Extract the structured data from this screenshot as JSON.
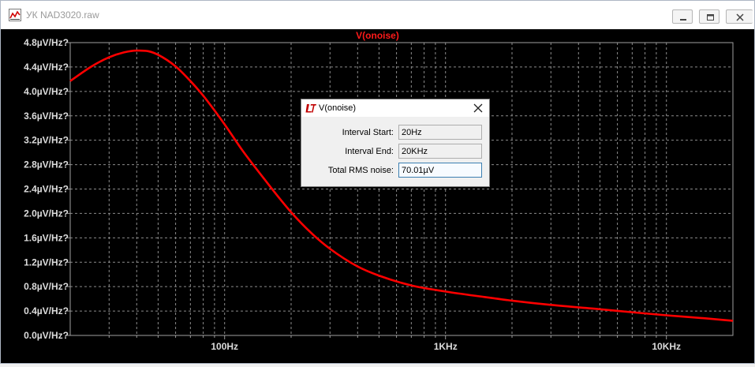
{
  "window": {
    "title": "УК NAD3020.raw",
    "minimize_icon": "minimize-icon",
    "restore_icon": "restore-icon",
    "close_icon": "close-icon"
  },
  "plot": {
    "title": "V(onoise)",
    "trace_color": "#ff0000",
    "background": "#000000"
  },
  "chart_data": {
    "type": "line",
    "title": "V(onoise)",
    "x_scale": "log",
    "x_range_hz": [
      20,
      20000
    ],
    "xlabel": "",
    "ylabel": "",
    "ylim": [
      0.0,
      4.8
    ],
    "grid": true,
    "yticks": [
      "0.0µV/Hz?",
      "0.4µV/Hz?",
      "0.8µV/Hz?",
      "1.2µV/Hz?",
      "1.6µV/Hz?",
      "2.0µV/Hz?",
      "2.4µV/Hz?",
      "2.8µV/Hz?",
      "3.2µV/Hz?",
      "3.6µV/Hz?",
      "4.0µV/Hz?",
      "4.4µV/Hz?",
      "4.8µV/Hz?"
    ],
    "xticks": [
      {
        "hz": 100,
        "label": "100Hz"
      },
      {
        "hz": 1000,
        "label": "1KHz"
      },
      {
        "hz": 10000,
        "label": "10KHz"
      }
    ],
    "series": [
      {
        "name": "V(onoise)",
        "color": "#ff0000",
        "x": [
          20,
          25,
          30,
          35,
          40,
          45,
          50,
          60,
          70,
          80,
          100,
          120,
          150,
          200,
          250,
          300,
          400,
          500,
          700,
          1000,
          1500,
          2000,
          3000,
          5000,
          7000,
          10000,
          15000,
          20000
        ],
        "y": [
          4.17,
          4.41,
          4.56,
          4.64,
          4.67,
          4.66,
          4.6,
          4.41,
          4.17,
          3.93,
          3.46,
          3.04,
          2.58,
          2.02,
          1.66,
          1.42,
          1.13,
          0.98,
          0.82,
          0.72,
          0.63,
          0.57,
          0.5,
          0.43,
          0.38,
          0.33,
          0.28,
          0.24
        ]
      }
    ]
  },
  "dialog": {
    "title": "V(onoise)",
    "logo_icon": "ltspice-logo-icon",
    "close_icon": "close-icon",
    "fields": [
      {
        "label": "Interval Start:",
        "value": "20Hz"
      },
      {
        "label": "Interval End:",
        "value": "20KHz"
      },
      {
        "label": "Total RMS noise:",
        "value": "70.01µV"
      }
    ]
  }
}
